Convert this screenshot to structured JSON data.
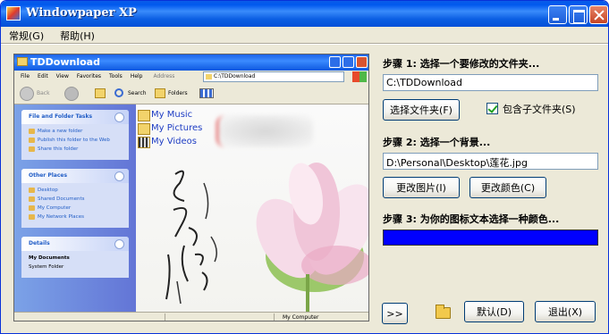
{
  "window": {
    "title": "Windowpaper XP"
  },
  "menu": [
    "常规(G)",
    "帮助(H)"
  ],
  "preview": {
    "title": "TDDownload",
    "menu": [
      "File",
      "Edit",
      "View",
      "Favorites",
      "Tools",
      "Help"
    ],
    "address_label": "Address",
    "address": "C:\\TDDownload",
    "toolbar": {
      "back": "Back",
      "search": "Search",
      "folders": "Folders"
    },
    "panels": {
      "tasks": {
        "title": "File and Folder Tasks",
        "items": [
          "Make a new folder",
          "Publish this folder to the Web",
          "Share this folder"
        ]
      },
      "places": {
        "title": "Other Places",
        "items": [
          "Desktop",
          "Shared Documents",
          "My Computer",
          "My Network Places"
        ]
      },
      "details": {
        "title": "Details",
        "name": "My Documents",
        "type": "System Folder"
      }
    },
    "items": [
      "My Music",
      "My Pictures",
      "My Videos"
    ],
    "status": "My Computer"
  },
  "step1": {
    "label": "步骤 1: 选择一个要修改的文件夹...",
    "path": "C:\\TDDownload",
    "button": "选择文件夹(F)",
    "checkbox_label": "包含子文件夹(S)",
    "checked": true
  },
  "step2": {
    "label": "步骤 2: 选择一个背景...",
    "path": "D:\\Personal\\Desktop\\莲花.jpg",
    "change_image": "更改图片(I)",
    "change_color": "更改颜色(C)"
  },
  "step3": {
    "label": "步骤 3: 为你的图标文本选择一种颜色...",
    "color": "#0000ff"
  },
  "bottom": {
    "expand": ">>",
    "default": "默认(D)",
    "exit": "退出(X)"
  }
}
